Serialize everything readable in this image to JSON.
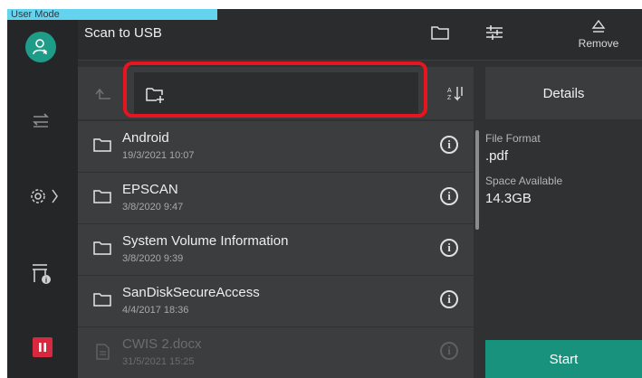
{
  "user_mode": "User Mode",
  "header": {
    "title": "Scan to USB",
    "folder_icon": "folder-icon",
    "settings_icon": "sliders-icon",
    "remove_label": "Remove",
    "remove_icon": "eject-icon"
  },
  "path": {
    "up_icon": "up-arrow-icon",
    "folder_icon": "new-folder-icon",
    "sort_icon": "sort-icon"
  },
  "details_label": "Details",
  "files": [
    {
      "name": "Android",
      "date": "19/3/2021 10:07",
      "enabled": true
    },
    {
      "name": "EPSCAN",
      "date": "3/8/2020 9:47",
      "enabled": true
    },
    {
      "name": "System Volume Information",
      "date": "3/8/2020 9:39",
      "enabled": true
    },
    {
      "name": "SanDiskSecureAccess",
      "date": "4/4/2017 18:36",
      "enabled": true
    },
    {
      "name": "CWIS 2.docx",
      "date": "31/5/2021 15:25",
      "enabled": false
    }
  ],
  "info_glyph": "i",
  "panel": {
    "file_format_label": "File Format",
    "file_format_value": ".pdf",
    "space_label": "Space Available",
    "space_value": "14.3GB"
  },
  "start_label": "Start",
  "colors": {
    "accent_green": "#18917d",
    "highlight_red": "#e8141e",
    "user_mode_bar": "#63d3ef",
    "stop_red": "#d8283f"
  }
}
